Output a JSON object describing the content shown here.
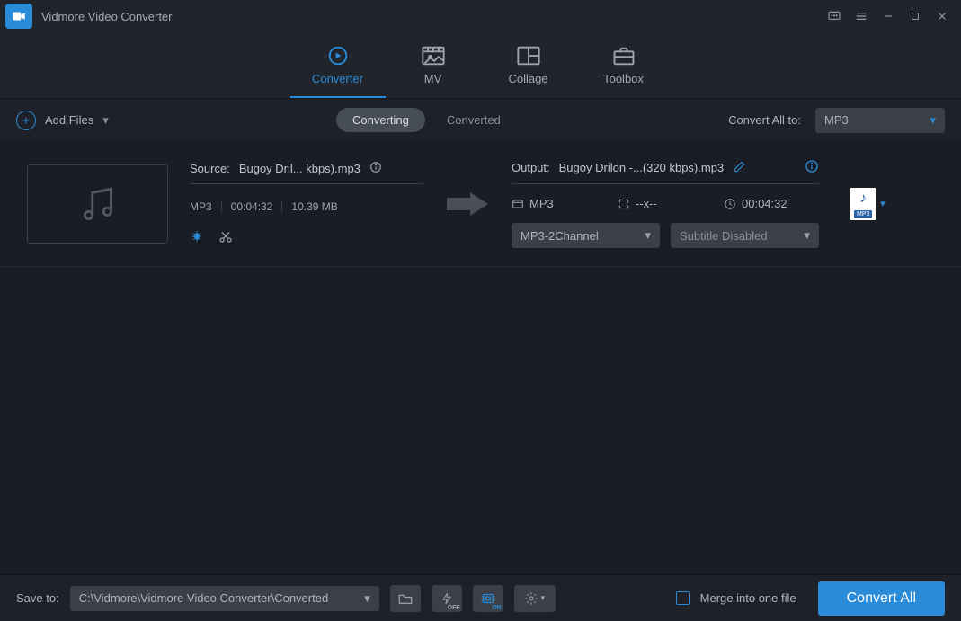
{
  "app": {
    "title": "Vidmore Video Converter"
  },
  "nav": {
    "converter": "Converter",
    "mv": "MV",
    "collage": "Collage",
    "toolbox": "Toolbox"
  },
  "subbar": {
    "addfiles": "Add Files",
    "tab_converting": "Converting",
    "tab_converted": "Converted",
    "convertall_label": "Convert All to:",
    "convertall_value": "MP3"
  },
  "file": {
    "source_prefix": "Source:",
    "source_name": "Bugoy Dril... kbps).mp3",
    "format": "MP3",
    "duration": "00:04:32",
    "size": "10.39 MB",
    "output_prefix": "Output:",
    "output_name": "Bugoy Drilon -...(320 kbps).mp3",
    "out_format": "MP3",
    "out_resolution": "--x--",
    "out_duration": "00:04:32",
    "audio_select": "MP3-2Channel",
    "subtitle_select": "Subtitle Disabled",
    "fmt_badge": "MP3"
  },
  "bottom": {
    "saveto_label": "Save to:",
    "save_path": "C:\\Vidmore\\Vidmore Video Converter\\Converted",
    "flash_label": "OFF",
    "gpu_label": "ON",
    "merge_label": "Merge into one file",
    "convert_label": "Convert All"
  }
}
